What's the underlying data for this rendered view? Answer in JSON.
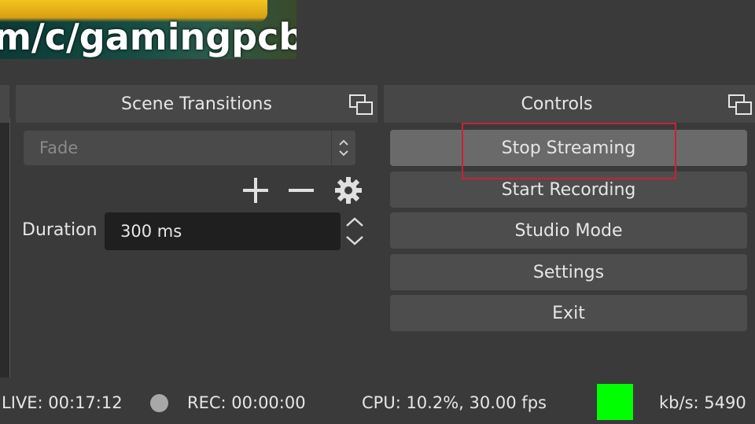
{
  "preview": {
    "url_text": "m/c/gamingpcbu"
  },
  "transitions": {
    "title": "Scene Transitions",
    "selected": "Fade",
    "duration_label": "Duration",
    "duration_value": "300 ms"
  },
  "controls": {
    "title": "Controls",
    "buttons": [
      "Stop Streaming",
      "Start Recording",
      "Studio Mode",
      "Settings",
      "Exit"
    ]
  },
  "status": {
    "live": "LIVE: 00:17:12",
    "rec": "REC: 00:00:00",
    "cpu": "CPU: 10.2%, 30.00 fps",
    "kbs": "kb/s: 5490",
    "network_color": "#00ff00"
  },
  "colors": {
    "highlight": "#c8213a"
  }
}
